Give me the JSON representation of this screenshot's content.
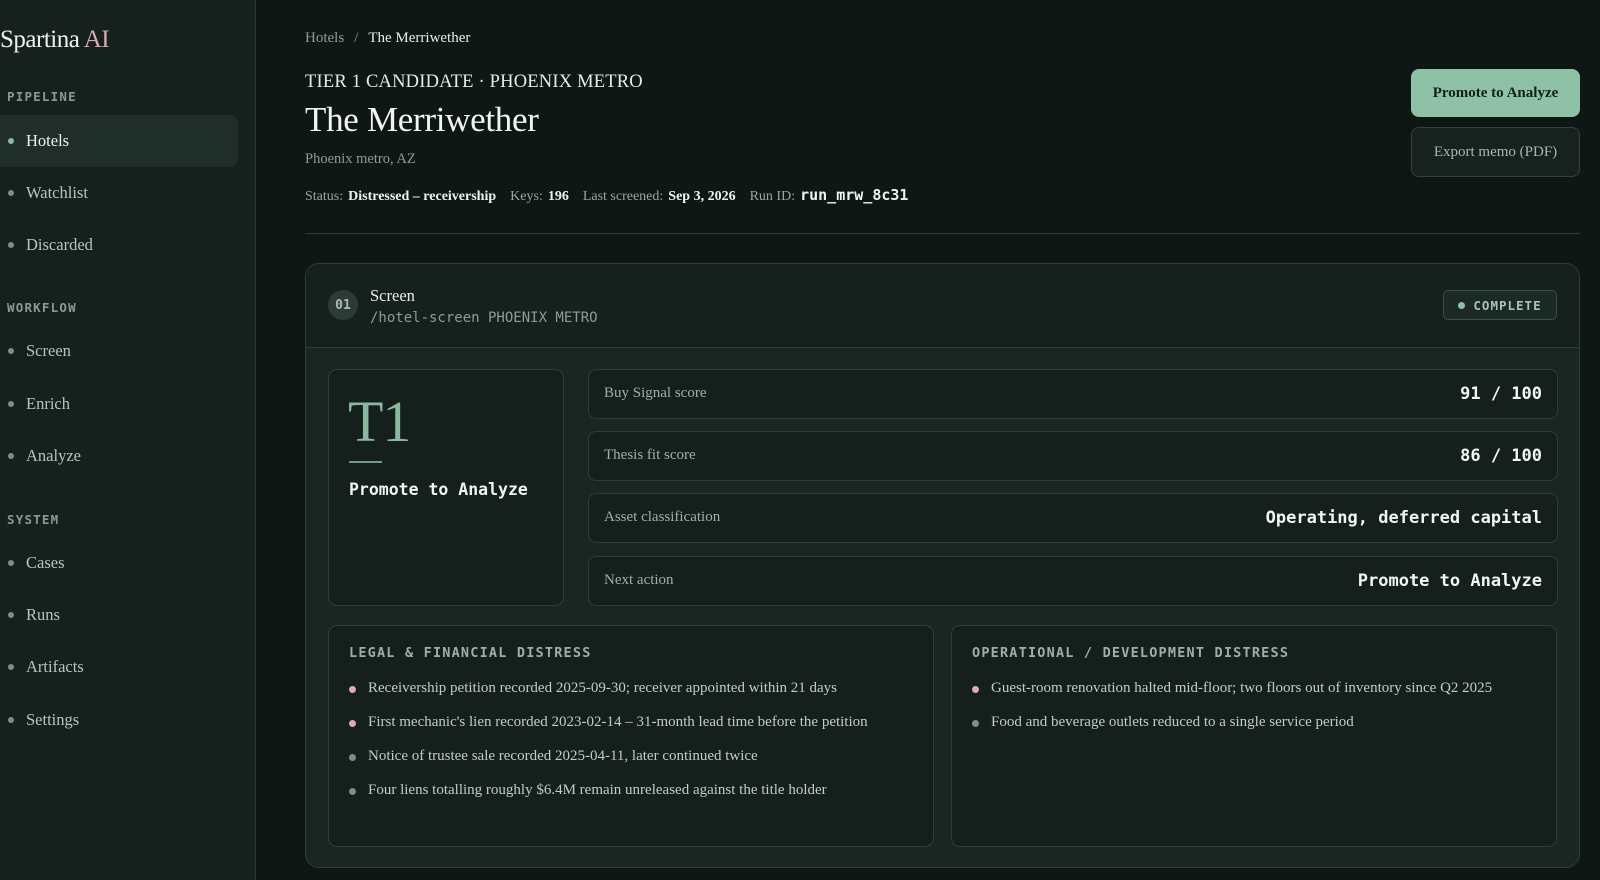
{
  "brand": {
    "name": "Spartina",
    "suffix": "AI"
  },
  "sidebar": {
    "sections": [
      {
        "label": "PIPELINE",
        "items": [
          {
            "label": "Hotels",
            "active": true
          },
          {
            "label": "Watchlist"
          },
          {
            "label": "Discarded"
          }
        ]
      },
      {
        "label": "WORKFLOW",
        "items": [
          {
            "label": "Screen"
          },
          {
            "label": "Enrich"
          },
          {
            "label": "Analyze"
          }
        ]
      },
      {
        "label": "SYSTEM",
        "items": [
          {
            "label": "Cases"
          },
          {
            "label": "Runs"
          },
          {
            "label": "Artifacts"
          },
          {
            "label": "Settings"
          }
        ]
      }
    ]
  },
  "breadcrumb": {
    "parent": "Hotels",
    "separator": "/",
    "current": "The Merriwether"
  },
  "header": {
    "eyebrow": "TIER 1 CANDIDATE · PHOENIX METRO",
    "title": "The Merriwether",
    "location": "Phoenix metro, AZ",
    "meta": {
      "status_label": "Status:",
      "status_value": "Distressed – receivership",
      "keys_label": "Keys:",
      "keys_value": "196",
      "screened_label": "Last screened:",
      "screened_value": "Sep 3, 2026",
      "run_label": "Run ID:",
      "run_value": "run_mrw_8c31"
    },
    "primary_button": "Promote to Analyze",
    "secondary_button": "Export memo (PDF)"
  },
  "step": {
    "number": "01",
    "title": "Screen",
    "command": "/hotel-screen PHOENIX METRO",
    "status": "COMPLETE",
    "tier": {
      "label": "T1",
      "action": "Promote to Analyze"
    },
    "metrics": [
      {
        "label": "Buy Signal score",
        "value": "91 / 100"
      },
      {
        "label": "Thesis fit score",
        "value": "86 / 100"
      },
      {
        "label": "Asset classification",
        "value": "Operating, deferred capital"
      },
      {
        "label": "Next action",
        "value": "Promote to Analyze"
      }
    ],
    "legal": {
      "title": "LEGAL & FINANCIAL DISTRESS",
      "items": [
        {
          "text": "Receivership petition recorded 2025-09-30; receiver appointed within 21 days",
          "highlight": true
        },
        {
          "text": "First mechanic's lien recorded 2023-02-14 – 31-month lead time before the petition",
          "highlight": true
        },
        {
          "text": "Notice of trustee sale recorded 2025-04-11, later continued twice",
          "highlight": false
        },
        {
          "text": "Four liens totalling roughly $6.4M remain unreleased against the title holder",
          "highlight": false
        }
      ]
    },
    "operational": {
      "title": "OPERATIONAL / DEVELOPMENT DISTRESS",
      "items": [
        {
          "text": "Guest-room renovation halted mid-floor; two floors out of inventory since Q2 2025",
          "highlight": true
        },
        {
          "text": "Food and beverage outlets reduced to a single service period",
          "highlight": false
        }
      ]
    }
  },
  "colors": {
    "accent": "#8fc1a6",
    "highlight_bullet": "#e3a9b3",
    "background": "#0f1714"
  }
}
